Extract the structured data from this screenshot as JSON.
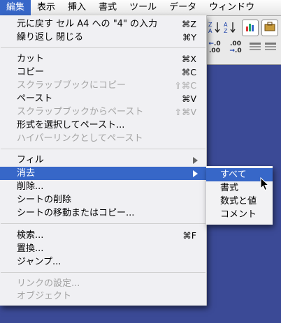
{
  "menubar": {
    "items": [
      {
        "label": "編集",
        "active": true
      },
      {
        "label": "表示",
        "active": false
      },
      {
        "label": "挿入",
        "active": false
      },
      {
        "label": "書式",
        "active": false
      },
      {
        "label": "ツール",
        "active": false
      },
      {
        "label": "データ",
        "active": false
      },
      {
        "label": "ウィンドウ",
        "active": false
      }
    ]
  },
  "toolbar_bg": {
    "icons": [
      "sort-descending-icon",
      "sort-ascending-icon",
      "chart-icon",
      "toolbox-icon",
      "increase-decimal-icon",
      "decrease-decimal-icon"
    ],
    "increase_decimal_text": "+.0\n.00",
    "decrease_decimal_text": ".00\n→.0"
  },
  "edit_menu": {
    "items": [
      {
        "label": "元に戻す セル A4 への \"4\" の入力",
        "shortcut": "⌘Z",
        "disabled": false
      },
      {
        "label": "繰り返し 閉じる",
        "shortcut": "⌘Y",
        "disabled": false
      },
      {
        "label": "カット",
        "shortcut": "⌘X",
        "disabled": false
      },
      {
        "label": "コピー",
        "shortcut": "⌘C",
        "disabled": false
      },
      {
        "label": "スクラップブックにコピー",
        "shortcut": "⇧⌘C",
        "disabled": true
      },
      {
        "label": "ペースト",
        "shortcut": "⌘V",
        "disabled": false
      },
      {
        "label": "スクラップブックからペースト",
        "shortcut": "⇧⌘V",
        "disabled": true
      },
      {
        "label": "形式を選択してペースト...",
        "shortcut": "",
        "disabled": false
      },
      {
        "label": "ハイパーリンクとしてペースト",
        "shortcut": "",
        "disabled": true
      },
      {
        "label": "フィル",
        "shortcut": "",
        "disabled": false,
        "submenu": true
      },
      {
        "label": "消去",
        "shortcut": "",
        "disabled": false,
        "submenu": true,
        "highlighted": true
      },
      {
        "label": "削除...",
        "shortcut": "",
        "disabled": false
      },
      {
        "label": "シートの削除",
        "shortcut": "",
        "disabled": false
      },
      {
        "label": "シートの移動またはコピー...",
        "shortcut": "",
        "disabled": false
      },
      {
        "label": "検索...",
        "shortcut": "⌘F",
        "disabled": false
      },
      {
        "label": "置換...",
        "shortcut": "",
        "disabled": false
      },
      {
        "label": "ジャンプ...",
        "shortcut": "",
        "disabled": false
      },
      {
        "label": "リンクの設定...",
        "shortcut": "",
        "disabled": true
      },
      {
        "label": "オブジェクト",
        "shortcut": "",
        "disabled": true
      }
    ]
  },
  "clear_submenu": {
    "items": [
      {
        "label": "すべて",
        "highlighted": true
      },
      {
        "label": "書式",
        "highlighted": false
      },
      {
        "label": "数式と値",
        "highlighted": false
      },
      {
        "label": "コメント",
        "highlighted": false
      }
    ]
  },
  "colors": {
    "highlight": "#3767c8",
    "background": "#3b4a96",
    "disabled_text": "#a3a3a3"
  }
}
